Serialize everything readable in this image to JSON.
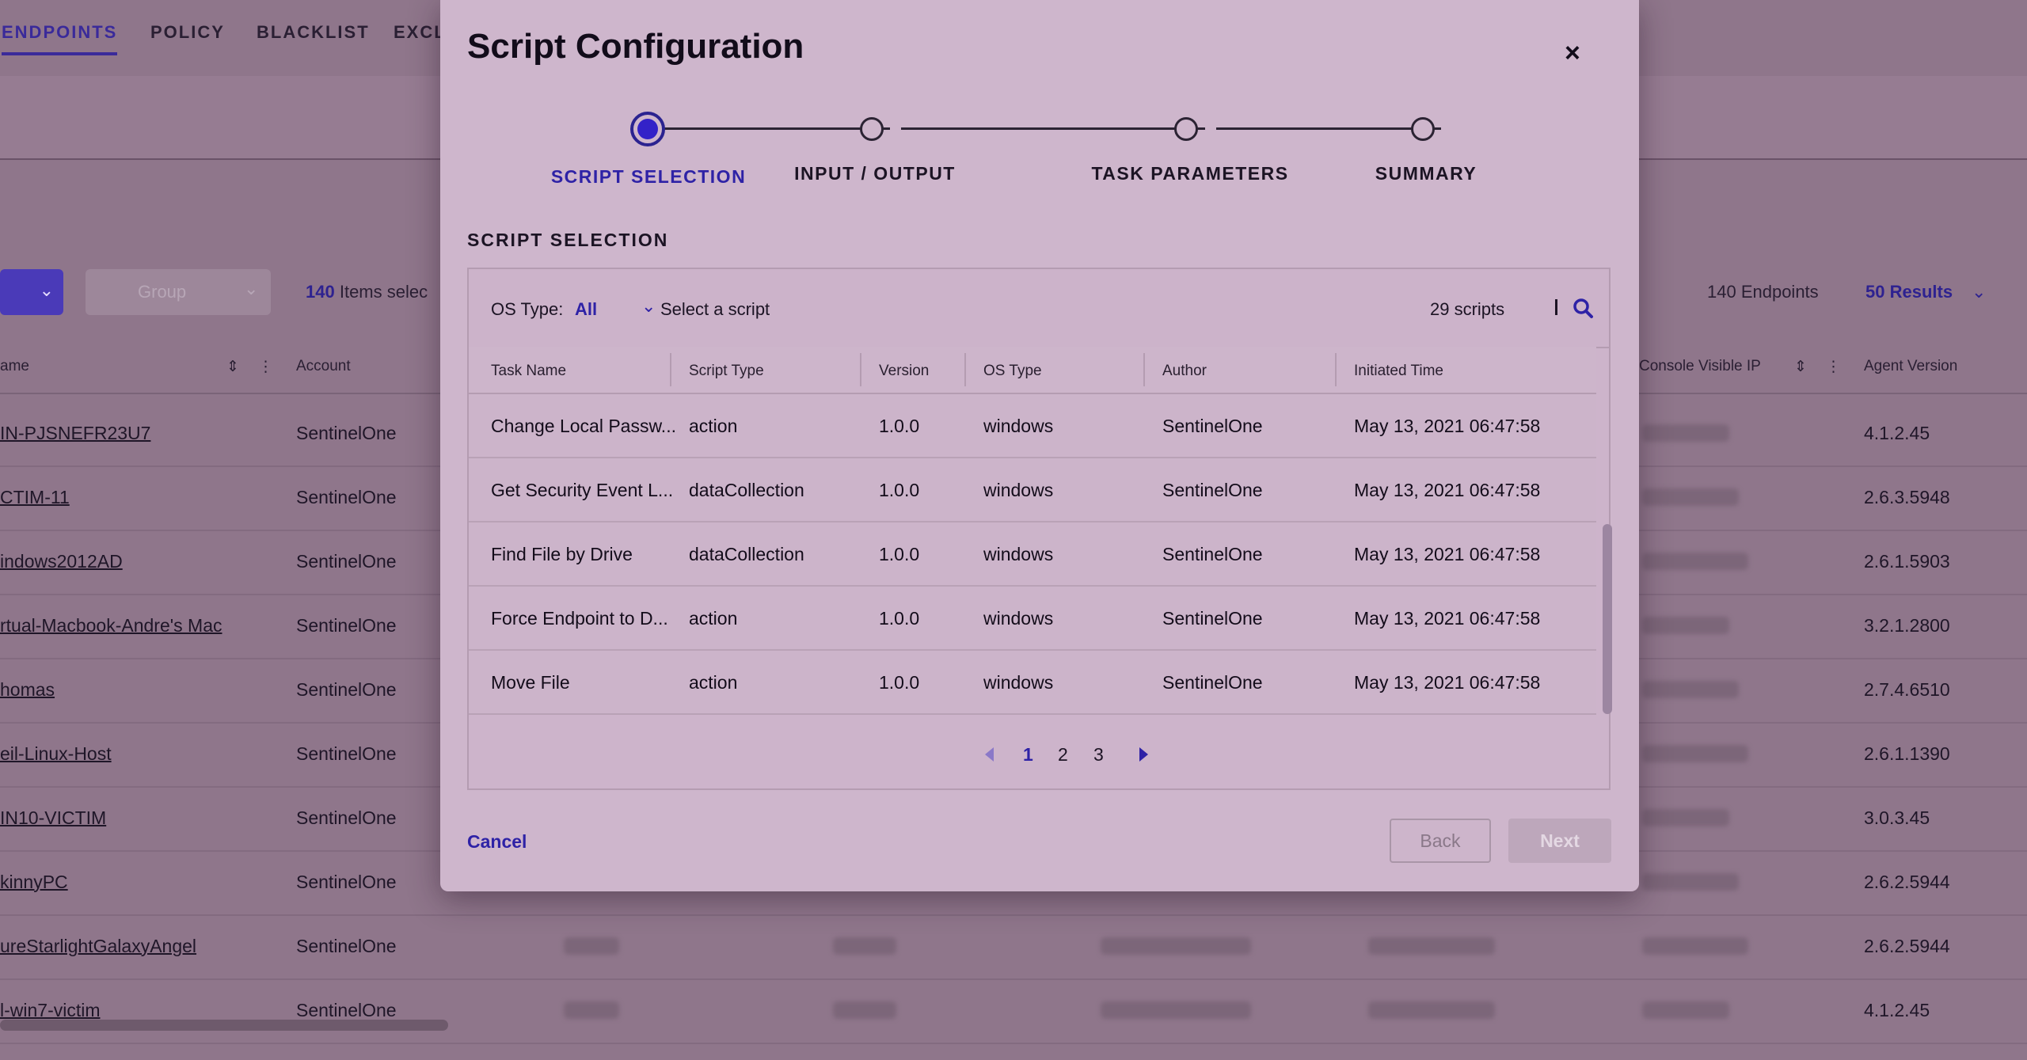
{
  "background": {
    "nav_tabs": [
      "ENDPOINTS",
      "POLICY",
      "BLACKLIST",
      "EXCL"
    ],
    "group_button": "Group",
    "selected_count": "140",
    "selected_suffix": "Items selec",
    "endpoints_count": "140 Endpoints",
    "results_label": "50 Results",
    "columns": {
      "name": "ame",
      "account": "Account",
      "console_ip": "Console Visible IP",
      "agent_version": "Agent Version"
    },
    "rows": [
      {
        "name": "IN-PJSNEFR23U7",
        "account": "SentinelOne",
        "version": "4.1.2.45"
      },
      {
        "name": "CTIM-11",
        "account": "SentinelOne",
        "version": "2.6.3.5948"
      },
      {
        "name": "indows2012AD",
        "account": "SentinelOne",
        "version": "2.6.1.5903"
      },
      {
        "name": "rtual-Macbook-Andre's Mac",
        "account": "SentinelOne",
        "version": "3.2.1.2800"
      },
      {
        "name": "homas",
        "account": "SentinelOne",
        "version": "2.7.4.6510"
      },
      {
        "name": "eil-Linux-Host",
        "account": "SentinelOne",
        "version": "2.6.1.1390"
      },
      {
        "name": "IN10-VICTIM",
        "account": "SentinelOne",
        "version": "3.0.3.45"
      },
      {
        "name": "kinnyPC",
        "account": "SentinelOne",
        "version": "2.6.2.5944"
      },
      {
        "name": "ureStarlightGalaxyAngel",
        "account": "SentinelOne",
        "version": "2.6.2.5944"
      },
      {
        "name": "l-win7-victim",
        "account": "SentinelOne",
        "version": "4.1.2.45"
      }
    ]
  },
  "modal": {
    "title": "Script Configuration",
    "close_symbol": "×",
    "steps": [
      {
        "label": "SCRIPT SELECTION",
        "active": true
      },
      {
        "label": "INPUT / OUTPUT",
        "active": false
      },
      {
        "label": "TASK PARAMETERS",
        "active": false
      },
      {
        "label": "SUMMARY",
        "active": false
      }
    ],
    "section_title": "SCRIPT SELECTION",
    "filter": {
      "os_label": "OS Type:",
      "os_value": "All",
      "select_text": "Select a script",
      "count": "29 scripts"
    },
    "table": {
      "headers": [
        "Task Name",
        "Script Type",
        "Version",
        "OS Type",
        "Author",
        "Initiated Time"
      ],
      "rows": [
        [
          "Change Local Passw...",
          "action",
          "1.0.0",
          "windows",
          "SentinelOne",
          "May 13, 2021 06:47:58"
        ],
        [
          "Get Security Event L...",
          "dataCollection",
          "1.0.0",
          "windows",
          "SentinelOne",
          "May 13, 2021 06:47:58"
        ],
        [
          "Find File by Drive",
          "dataCollection",
          "1.0.0",
          "windows",
          "SentinelOne",
          "May 13, 2021 06:47:58"
        ],
        [
          "Force Endpoint to D...",
          "action",
          "1.0.0",
          "windows",
          "SentinelOne",
          "May 13, 2021 06:47:58"
        ],
        [
          "Move File",
          "action",
          "1.0.0",
          "windows",
          "SentinelOne",
          "May 13, 2021 06:47:58"
        ]
      ]
    },
    "pagination": {
      "pages": [
        "1",
        "2",
        "3"
      ],
      "current": "1"
    },
    "cancel_label": "Cancel",
    "back_label": "Back",
    "next_label": "Next"
  },
  "colors": {
    "accent": "#2e22a6",
    "overlay": "#8f768b",
    "modal_bg": "#ceb6cc"
  }
}
